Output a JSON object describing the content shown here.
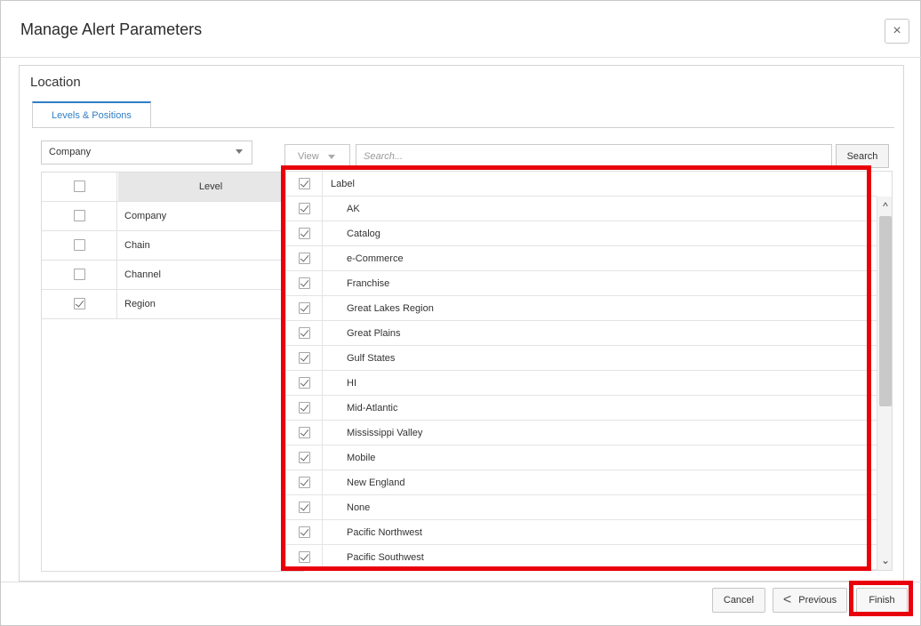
{
  "dialog": {
    "title": "Manage Alert Parameters",
    "close_label": "×"
  },
  "section": {
    "title": "Location",
    "tab_label": "Levels & Positions"
  },
  "level_select": {
    "value": "Company"
  },
  "level_table": {
    "header_level": "Level",
    "rows": [
      {
        "label": "Company",
        "checked": false
      },
      {
        "label": "Chain",
        "checked": false
      },
      {
        "label": "Channel",
        "checked": false
      },
      {
        "label": "Region",
        "checked": true
      }
    ]
  },
  "toolbar": {
    "view_label": "View",
    "search_placeholder": "Search...",
    "search_button": "Search"
  },
  "label_list": {
    "header": "Label",
    "items": [
      "AK",
      "Catalog",
      "e-Commerce",
      "Franchise",
      "Great Lakes Region",
      "Great Plains",
      "Gulf States",
      "HI",
      "Mid-Atlantic",
      "Mississippi Valley",
      "Mobile",
      "New England",
      "None",
      "Pacific Northwest",
      "Pacific Southwest"
    ]
  },
  "footer": {
    "cancel_label": "Cancel",
    "previous_label": "Previous",
    "finish_label": "Finish"
  },
  "colors": {
    "accent": "#2f7ec6",
    "highlight": "#e8000b"
  }
}
